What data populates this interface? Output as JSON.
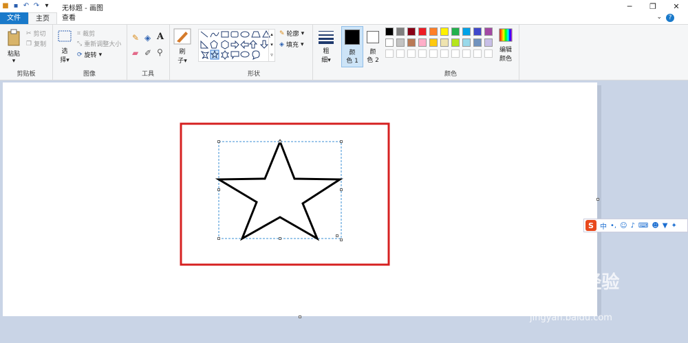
{
  "window": {
    "title": "无标题 - 画图"
  },
  "tabs": [
    {
      "label": "文件"
    },
    {
      "label": "主页"
    },
    {
      "label": "查看"
    }
  ],
  "ribbon": {
    "clipboard": {
      "group": "剪贴板",
      "paste": "粘贴",
      "cut": "剪切",
      "copy": "复制"
    },
    "image": {
      "group": "图像",
      "select": "选",
      "select2": "择",
      "crop": "裁剪",
      "resize": "重新调整大小",
      "rotate": "旋转"
    },
    "tools": {
      "group": "工具"
    },
    "brush": {
      "label": "刷",
      "label2": "子"
    },
    "shapes": {
      "group": "形状",
      "outline": "轮廓",
      "fill": "填充"
    },
    "size": {
      "label": "粗",
      "label2": "细"
    },
    "color1": {
      "label": "颜",
      "label2": "色 1"
    },
    "color2": {
      "label": "颜",
      "label2": "色 2"
    },
    "colors": {
      "group": "颜色",
      "edit": "编辑",
      "edit2": "颜色"
    }
  },
  "palette": {
    "row1": [
      "#000000",
      "#7f7f7f",
      "#880015",
      "#ed1c24",
      "#ff7f27",
      "#fff200",
      "#22b14c",
      "#00a2e8",
      "#3f48cc",
      "#a349a4"
    ],
    "row2": [
      "#ffffff",
      "#c3c3c3",
      "#b97a57",
      "#ffaec9",
      "#ffc90e",
      "#efe4b0",
      "#b5e61d",
      "#99d9ea",
      "#7092be",
      "#c8bfe7"
    ],
    "row3": [
      "#ffffff",
      "#ffffff",
      "#ffffff",
      "#ffffff",
      "#ffffff",
      "#ffffff",
      "#ffffff",
      "#ffffff",
      "#ffffff",
      "#ffffff"
    ],
    "color1": "#000000",
    "color2": "#ffffff",
    "highlight": "#d62020"
  },
  "ime": {
    "lang": "中"
  },
  "watermark": {
    "text": "Baidu经验",
    "url": "jingyan.baidu.com"
  }
}
